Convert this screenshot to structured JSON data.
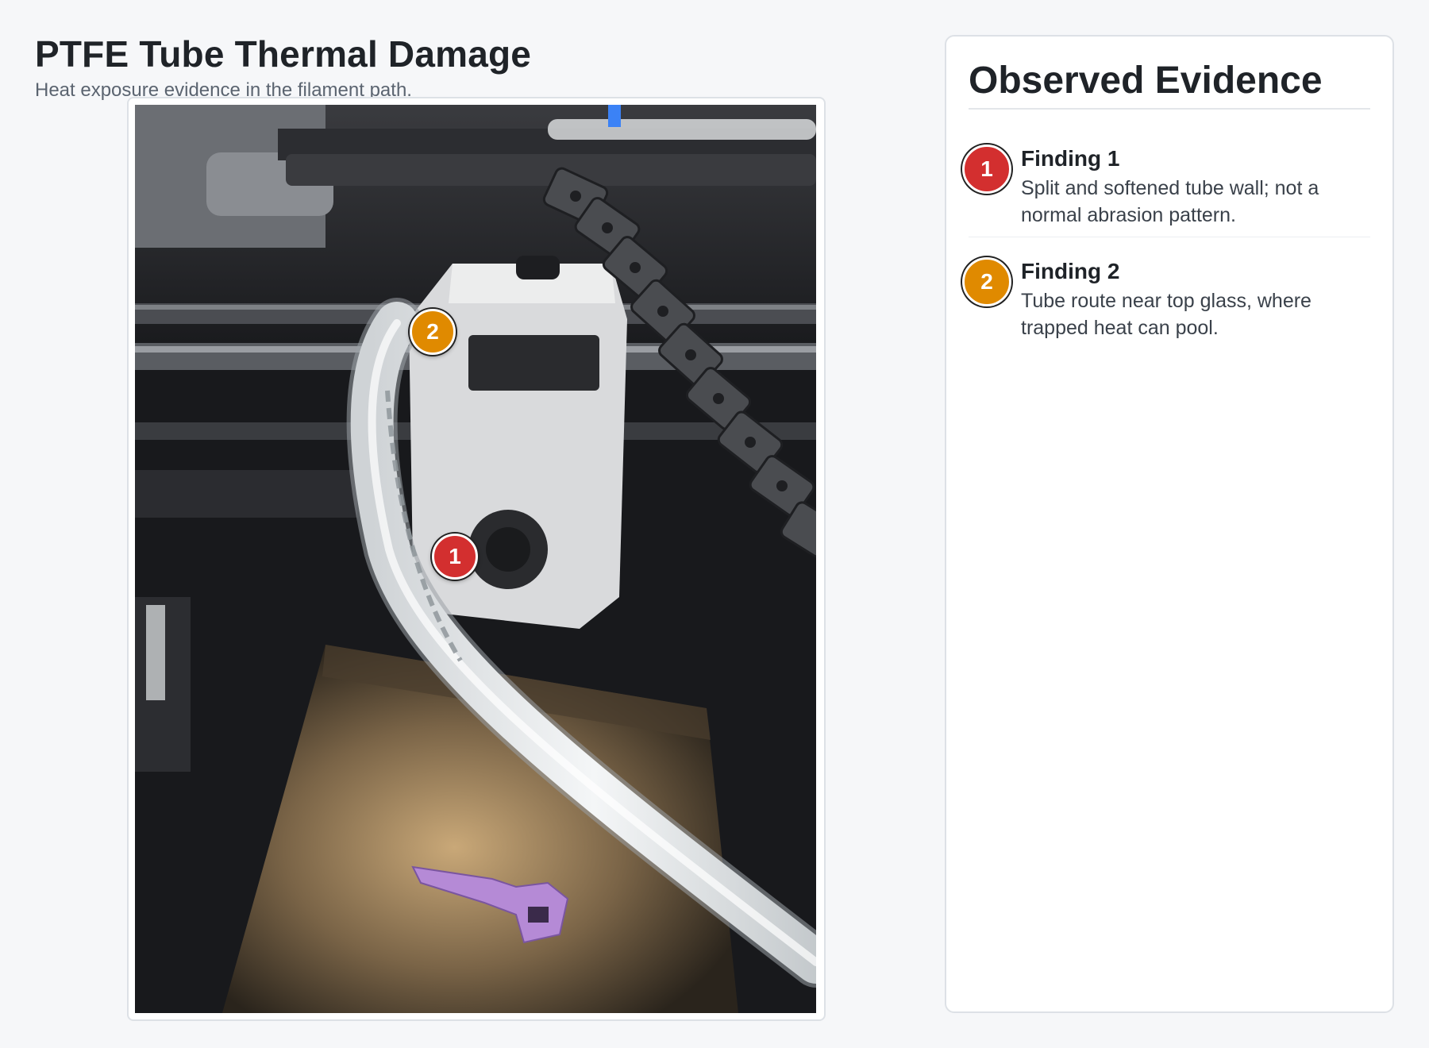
{
  "header": {
    "title": "PTFE Tube Thermal Damage",
    "subtitle": "Heat exposure evidence in the filament path."
  },
  "photo": {
    "markers": [
      {
        "label": "1",
        "color": "#d32f2f"
      },
      {
        "label": "2",
        "color": "#e08a00"
      }
    ]
  },
  "panel": {
    "title": "Observed Evidence",
    "findings": [
      {
        "number": "1",
        "title": "Finding 1",
        "text": "Split and softened tube wall; not a normal abrasion pattern.",
        "color": "#d32f2f"
      },
      {
        "number": "2",
        "title": "Finding 2",
        "text": "Tube route near top glass, where trapped heat can pool.",
        "color": "#e08a00"
      }
    ]
  }
}
